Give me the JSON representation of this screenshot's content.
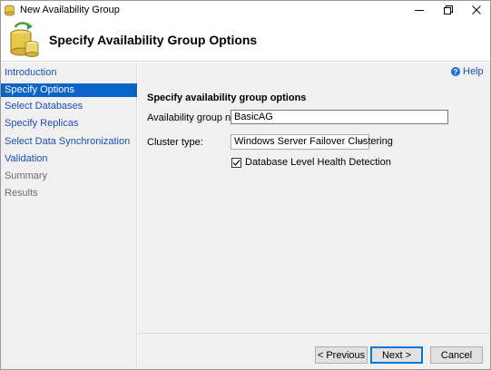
{
  "window": {
    "title": "New Availability Group",
    "icon": "availability-group-icon"
  },
  "header": {
    "title": "Specify Availability Group Options",
    "icon": "database-sync-icon"
  },
  "sidebar": {
    "items": [
      {
        "label": "Introduction",
        "state": "link"
      },
      {
        "label": "Specify Options",
        "state": "selected"
      },
      {
        "label": "Select Databases",
        "state": "link"
      },
      {
        "label": "Specify Replicas",
        "state": "link"
      },
      {
        "label": "Select Data Synchronization",
        "state": "link"
      },
      {
        "label": "Validation",
        "state": "link"
      },
      {
        "label": "Summary",
        "state": "disabled"
      },
      {
        "label": "Results",
        "state": "disabled"
      }
    ]
  },
  "main": {
    "help_label": "Help",
    "section_title": "Specify availability group options",
    "name_label": "Availability group name:",
    "name_value": "BasicAG",
    "cluster_label": "Cluster type:",
    "cluster_value": "Windows Server Failover Clustering",
    "health_label": "Database Level Health Detection",
    "health_checked": true
  },
  "footer": {
    "previous_label": "< Previous",
    "next_label": "Next >",
    "cancel_label": "Cancel"
  },
  "colors": {
    "accent": "#0a64c8",
    "link": "#1a4fb0",
    "panel": "#f0f0f0"
  }
}
